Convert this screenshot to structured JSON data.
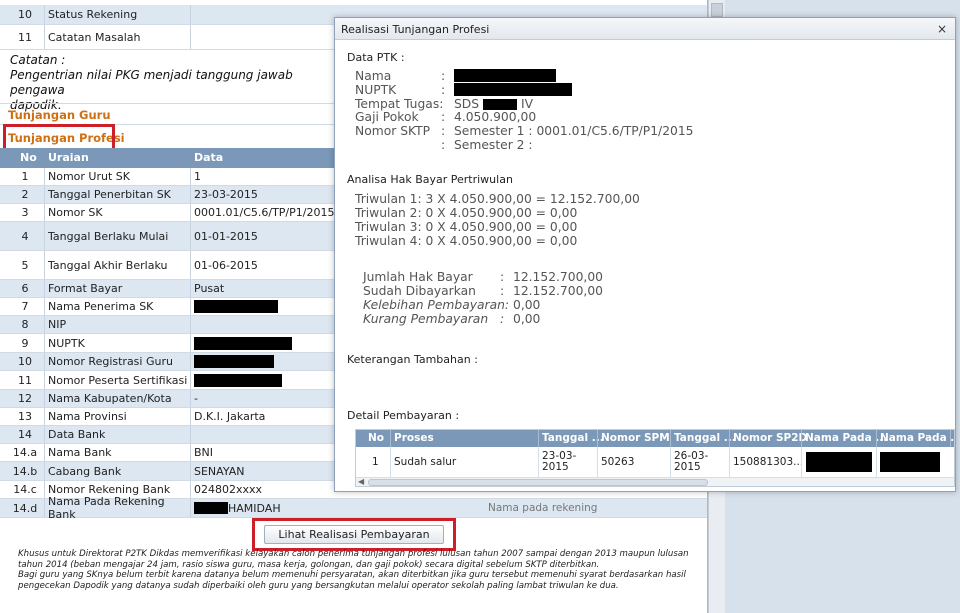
{
  "bg": {
    "top_rows": [
      {
        "no": "10",
        "label": "Status Rekening"
      },
      {
        "no": "11",
        "label": "Catatan Masalah"
      }
    ],
    "catatan_title": "Catatan :",
    "catatan_line1": "Pengentrian nilai PKG menjadi tanggung jawab pengawa",
    "catatan_line2": "dapodik.",
    "tunjangan_guru": "Tunjangan Guru",
    "tunjangan_profesi": "Tunjangan Profesi",
    "table_header": {
      "no": "No",
      "uraian": "Uraian",
      "data": "Data"
    },
    "rows": [
      {
        "no": "1",
        "uraian": "Nomor Urut SK",
        "data": "1"
      },
      {
        "no": "2",
        "uraian": "Tanggal Penerbitan SK",
        "data": "23-03-2015"
      },
      {
        "no": "3",
        "uraian": "Nomor SK",
        "data": "0001.01/C5.6/TP/P1/2015"
      },
      {
        "no": "4",
        "uraian": "Tanggal Berlaku Mulai",
        "data": "01-01-2015"
      },
      {
        "no": "5",
        "uraian": "Tanggal Akhir Berlaku",
        "data": "01-06-2015"
      },
      {
        "no": "6",
        "uraian": "Format Bayar",
        "data": "Pusat"
      },
      {
        "no": "7",
        "uraian": "Nama Penerima SK",
        "data": ""
      },
      {
        "no": "8",
        "uraian": "NIP",
        "data": ""
      },
      {
        "no": "9",
        "uraian": "NUPTK",
        "data": ""
      },
      {
        "no": "10",
        "uraian": "Nomor Registrasi Guru",
        "data": ""
      },
      {
        "no": "11",
        "uraian": "Nomor Peserta Sertifikasi",
        "data": ""
      },
      {
        "no": "12",
        "uraian": "Nama Kabupaten/Kota",
        "data": "-"
      },
      {
        "no": "13",
        "uraian": "Nama Provinsi",
        "data": "D.K.I. Jakarta"
      },
      {
        "no": "14",
        "uraian": "Data Bank",
        "data": ""
      },
      {
        "no": "14.a",
        "uraian": "Nama Bank",
        "data": "BNI"
      },
      {
        "no": "14.b",
        "uraian": "Cabang Bank",
        "data": "SENAYAN"
      },
      {
        "no": "14.c",
        "uraian": "Nomor Rekening Bank",
        "data": "024802xxxx"
      },
      {
        "no": "14.d",
        "uraian": "Nama Pada Rekening Bank",
        "data": "HAMIDAH"
      }
    ],
    "row14d_extra": "Nama pada rekening",
    "lihat_button": "Lihat Realisasi Pembayaran",
    "footer_note": "Khusus untuk Direktorat P2TK Dikdas memverifikasi kelayakan calon penerima tunjangan profesi lulusan tahun 2007 sampai dengan 2013 maupun lulusan tahun 2014 (beban mengajar 24 jam, rasio siswa guru, masa kerja, golongan, dan gaji pokok) secara digital sebelum SKTP diterbitkan.",
    "footer_note2": "Bagi guru yang SKnya belum terbit karena datanya belum memenuhi persyaratan, akan diterbitkan jika guru tersebut memenuhi syarat berdasarkan hasil pengecekan Dapodik yang datanya sudah diperbaiki oleh guru yang bersangkutan melalui operator sekolah paling lambat triwulan ke dua."
  },
  "dialog": {
    "title": "Realisasi Tunjangan Profesi",
    "close": "×",
    "data_ptk": "Data PTK :",
    "fields": {
      "nama": "Nama",
      "nuptk": "NUPTK",
      "tempat_tugas": "Tempat Tugas:",
      "tempat_tugas_val_prefix": "SDS",
      "tempat_tugas_val_suffix": "IV",
      "gaji_pokok": "Gaji Pokok",
      "gaji_pokok_val": "4.050.900,00",
      "nomor_sktp": "Nomor SKTP",
      "semester1": "Semester 1 : 0001.01/C5.6/TP/P1/2015",
      "semester2": "Semester 2 :"
    },
    "analisa_title": "Analisa Hak Bayar Pertriwulan",
    "triwulan": [
      "Triwulan 1:  3 X 4.050.900,00 = 12.152.700,00",
      "Triwulan 2:  0 X 4.050.900,00 = 0,00",
      "Triwulan 3:  0 X 4.050.900,00 = 0,00",
      "Triwulan 4:  0 X 4.050.900,00 = 0,00"
    ],
    "summary": [
      {
        "label": "Jumlah Hak Bayar",
        "value": "12.152.700,00"
      },
      {
        "label": "Sudah Dibayarkan",
        "value": "12.152.700,00"
      },
      {
        "label": "Kelebihan Pembayaran:",
        "value": "0,00"
      },
      {
        "label": "Kurang Pembayaran",
        "value": "0,00"
      }
    ],
    "keterangan": "Keterangan Tambahan :",
    "detail": "Detail Pembayaran :",
    "pay_headers": [
      "No",
      "Proses",
      "Tanggal ...",
      "Nomor SPM",
      "Tanggal ...",
      "Nomor SP2D",
      "Nama Pada ...",
      "Nama Pada ..."
    ],
    "pay_row": {
      "no": "1",
      "proses": "Sudah salur",
      "tanggal1": "23-03-2015",
      "spm": "50263",
      "tanggal2": "26-03-2015",
      "sp2d": "150881303..."
    }
  }
}
